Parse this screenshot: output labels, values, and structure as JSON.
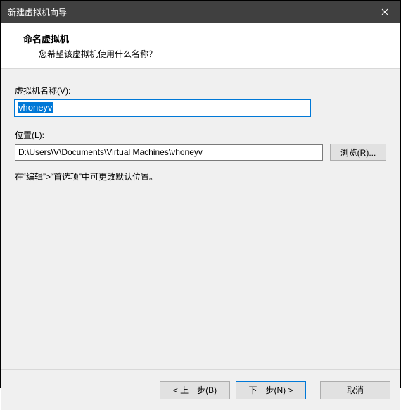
{
  "window": {
    "title": "新建虚拟机向导"
  },
  "header": {
    "heading": "命名虚拟机",
    "subheading": "您希望该虚拟机使用什么名称？"
  },
  "fields": {
    "name_label": "虚拟机名称(V):",
    "name_value": "vhoneyv",
    "location_label": "位置(L):",
    "location_value": "D:\\Users\\V\\Documents\\Virtual Machines\\vhoneyv",
    "browse_label": "浏览(R)..."
  },
  "hint": "在“编辑”>“首选项”中可更改默认位置。",
  "footer": {
    "back": "< 上一步(B)",
    "next": "下一步(N) >",
    "cancel": "取消"
  }
}
